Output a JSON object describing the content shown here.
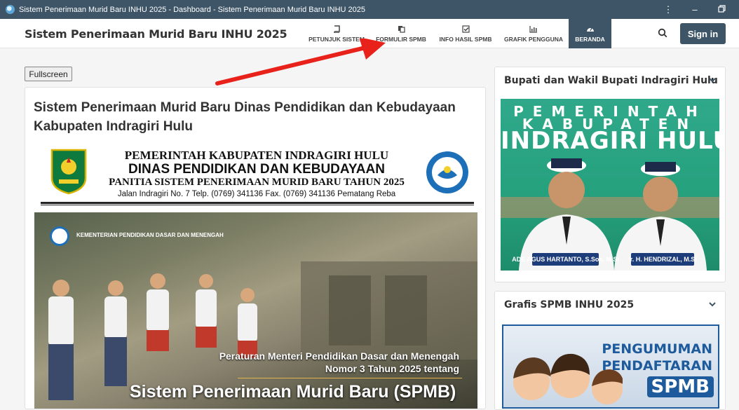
{
  "window": {
    "title": "Sistem Penerimaan Murid Baru INHU 2025 - Dashboard - Sistem Penerimaan Murid Baru INHU 2025",
    "menu_icon": "more-vertical-icon",
    "minimize_icon": "minimize-icon",
    "restore_icon": "restore-icon"
  },
  "navbar": {
    "brand": "Sistem Penerimaan Murid Baru INHU 2025",
    "items": [
      {
        "label": "PETUNJUK SISTEM",
        "icon": "book-icon"
      },
      {
        "label": "FORMULIR SPMB",
        "icon": "copy-icon"
      },
      {
        "label": "INFO HASIL SPMB",
        "icon": "check-square-icon"
      },
      {
        "label": "GRAFIK PENGGUNA",
        "icon": "bar-chart-icon"
      },
      {
        "label": "BERANDA",
        "icon": "dashboard-icon",
        "active": true
      }
    ],
    "signin_label": "Sign in",
    "accent": "#3d5567"
  },
  "main": {
    "fullscreen_label": "Fullscreen",
    "title": "Sistem Penerimaan Murid Baru Dinas Pendidikan dan Kebudayaan Kabupaten Indragiri Hulu",
    "letterhead": {
      "line1": "PEMERINTAH KABUPATEN INDRAGIRI HULU",
      "line2": "DINAS PENDIDIKAN DAN KEBUDAYAAN",
      "line3": "PANITIA SISTEM PENERIMAAN MURID BARU TAHUN 2025",
      "line4": "Jalan Indragiri No. 7 Telp. (0769) 341136 Fax. (0769) 341136 Pematang Reba"
    },
    "banner": {
      "ministry": "KEMENTERIAN PENDIDIKAN DASAR DAN MENENGAH",
      "subtitle1": "Peraturan Menteri Pendidikan Dasar dan Menengah",
      "subtitle2": "Nomor 3 Tahun 2025 tentang",
      "headline": "Sistem Penerimaan Murid Baru (SPMB)"
    }
  },
  "sidebar": {
    "panel1": {
      "title": "Bupati dan Wakil Bupati Indragiri Hulu",
      "poster_line1": "PEMERINTAH",
      "poster_line2": "KABUPATEN",
      "poster_line3": "INDRAGIRI HULU",
      "name1": "ADE AGUS HARTANTO, S.Sos, M.Si",
      "name2": "Ir. H. HENDRIZAL, M.Si"
    },
    "panel2": {
      "title": "Grafis SPMB INHU 2025",
      "line1": "PENGUMUMAN",
      "line2": "PENDAFTARAN",
      "line3": "SPMB"
    }
  }
}
